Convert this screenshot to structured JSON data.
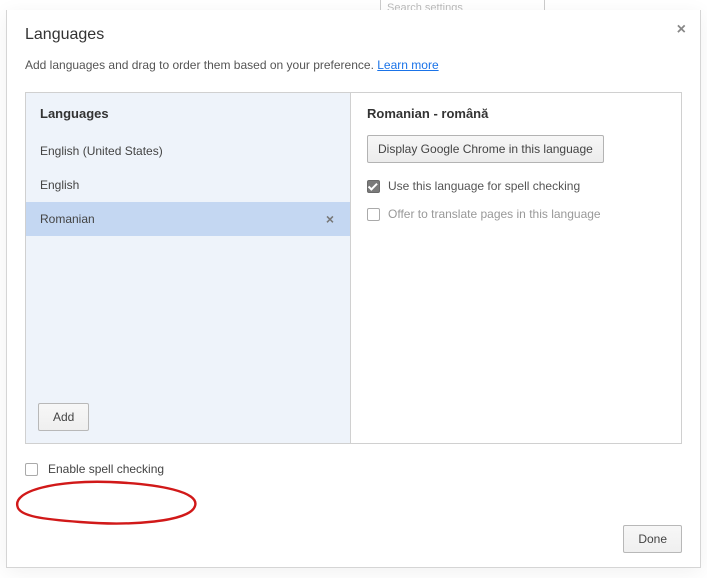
{
  "backdrop": {
    "search_placeholder": "Search settings"
  },
  "dialog": {
    "title": "Languages",
    "subtitle_pre": "Add languages and drag to order them based on your preference. ",
    "learn_more": "Learn more"
  },
  "left": {
    "header": "Languages",
    "items": [
      {
        "label": "English (United States)"
      },
      {
        "label": "English"
      },
      {
        "label": "Romanian"
      }
    ],
    "add_label": "Add"
  },
  "right": {
    "header": "Romanian - română",
    "display_button": "Display Google Chrome in this language",
    "spellcheck_label": "Use this language for spell checking",
    "translate_label": "Offer to translate pages in this language"
  },
  "enable_spellcheck_label": "Enable spell checking",
  "done_label": "Done"
}
